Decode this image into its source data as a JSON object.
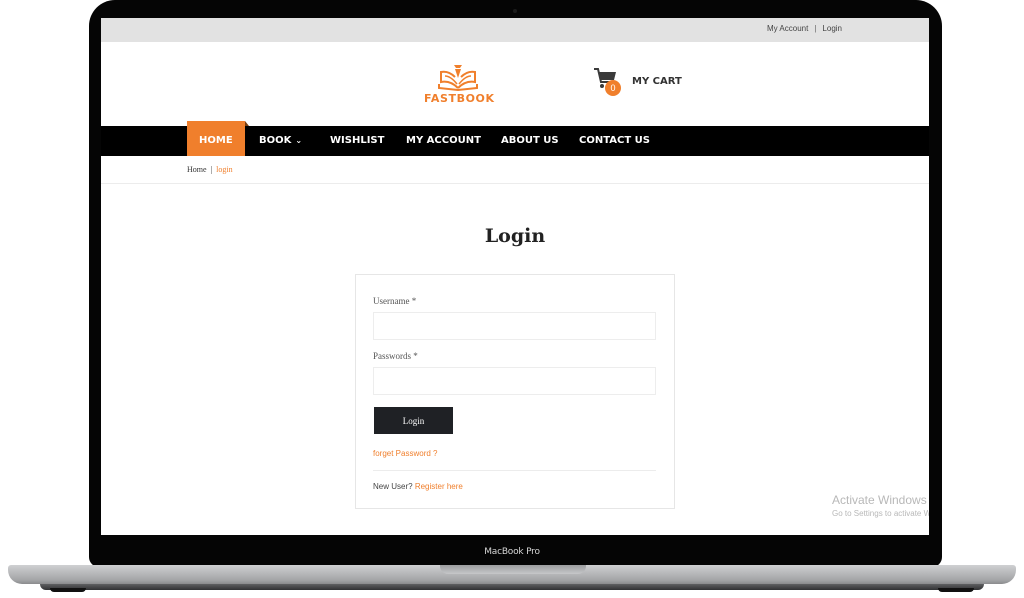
{
  "device": {
    "label": "MacBook Pro"
  },
  "topbar": {
    "my_account": "My Account",
    "separator": "|",
    "login": "Login"
  },
  "header": {
    "logo_text": "FASTBOOK",
    "cart": {
      "count": "0",
      "label": "MY CART"
    }
  },
  "nav": {
    "items": [
      {
        "label": "HOME",
        "active": true
      },
      {
        "label": "BOOK",
        "has_dropdown": true,
        "chevron": "⌄"
      },
      {
        "label": "WISHLIST"
      },
      {
        "label": "MY ACCOUNT"
      },
      {
        "label": "ABOUT US"
      },
      {
        "label": "CONTACT US"
      }
    ]
  },
  "breadcrumb": {
    "home": "Home",
    "separator": "|",
    "current": "login"
  },
  "page": {
    "title": "Login"
  },
  "form": {
    "username_label": "Username *",
    "username_value": "",
    "password_label": "Passwords *",
    "password_value": "",
    "submit_label": "Login",
    "forgot_link": "forget Password ?",
    "new_user_text": "New User?",
    "register_link": "Register here"
  },
  "watermark": {
    "title": "Activate Windows",
    "subtitle": "Go to Settings to activate Windows."
  },
  "colors": {
    "accent": "#f07f2c",
    "nav_bg": "#000000",
    "button_bg": "#1f2125",
    "topbar_bg": "#e2e2e2"
  }
}
